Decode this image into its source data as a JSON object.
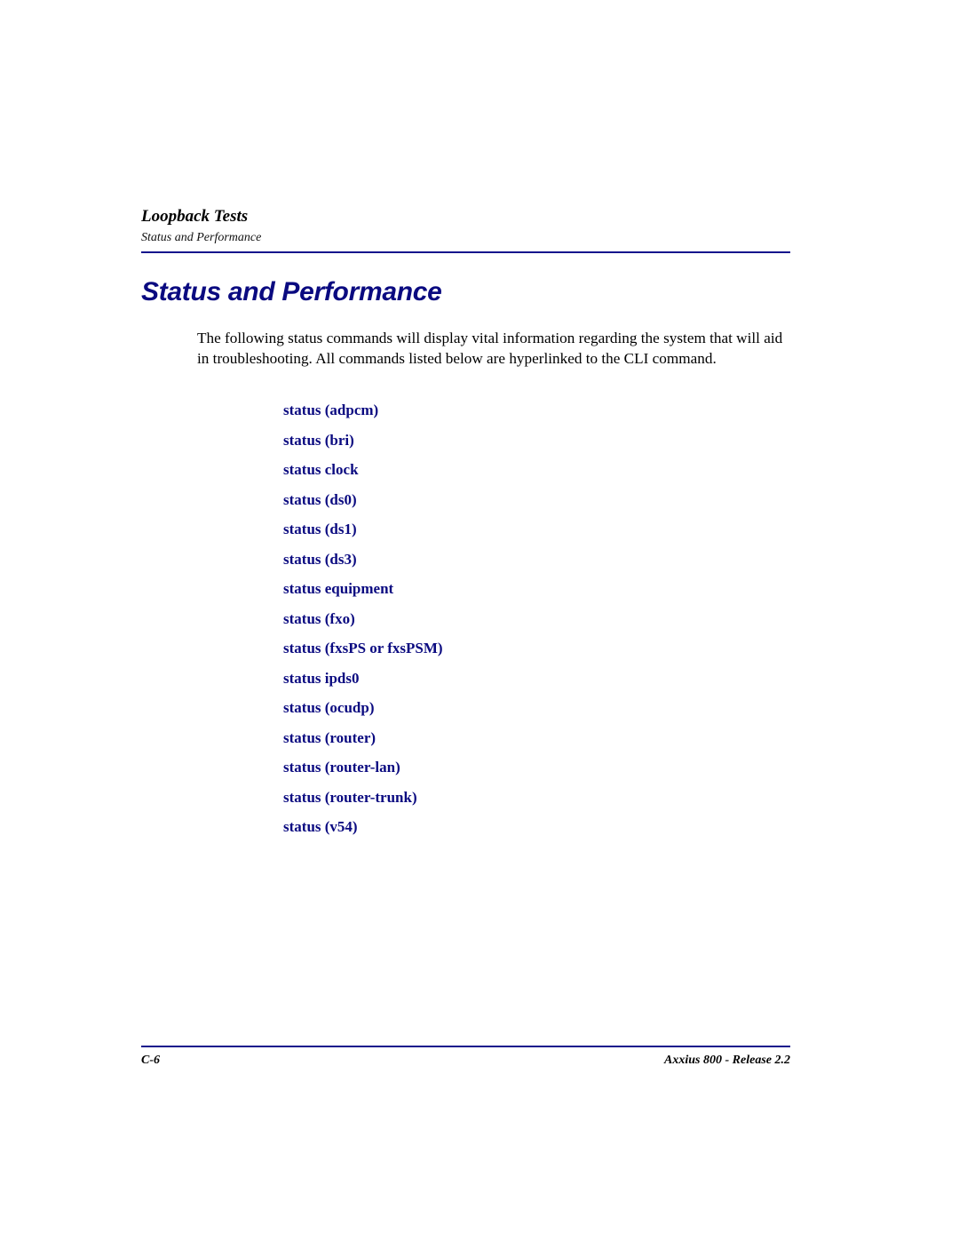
{
  "running_head": {
    "chapter": "Loopback Tests",
    "section": "Status and Performance"
  },
  "title": "Status and Performance",
  "intro": "The following status commands will display vital information regarding the system that will aid in troubleshooting. All commands listed below are hyperlinked to the CLI command.",
  "commands": [
    "status (adpcm)",
    "status (bri)",
    "status clock",
    "status (ds0)",
    "status (ds1)",
    "status (ds3)",
    "status equipment",
    "status (fxo)",
    "status (fxsPS or fxsPSM)",
    "status ipds0",
    "status (ocudp)",
    "status (router)",
    "status (router-lan)",
    "status (router-trunk)",
    "status (v54)"
  ],
  "footer": {
    "page_number": "C-6",
    "doc_title": "Axxius 800 - Release 2.2"
  },
  "colors": {
    "title": "#0a0a80",
    "rule": "#14148c",
    "link": "#0a0a80"
  }
}
